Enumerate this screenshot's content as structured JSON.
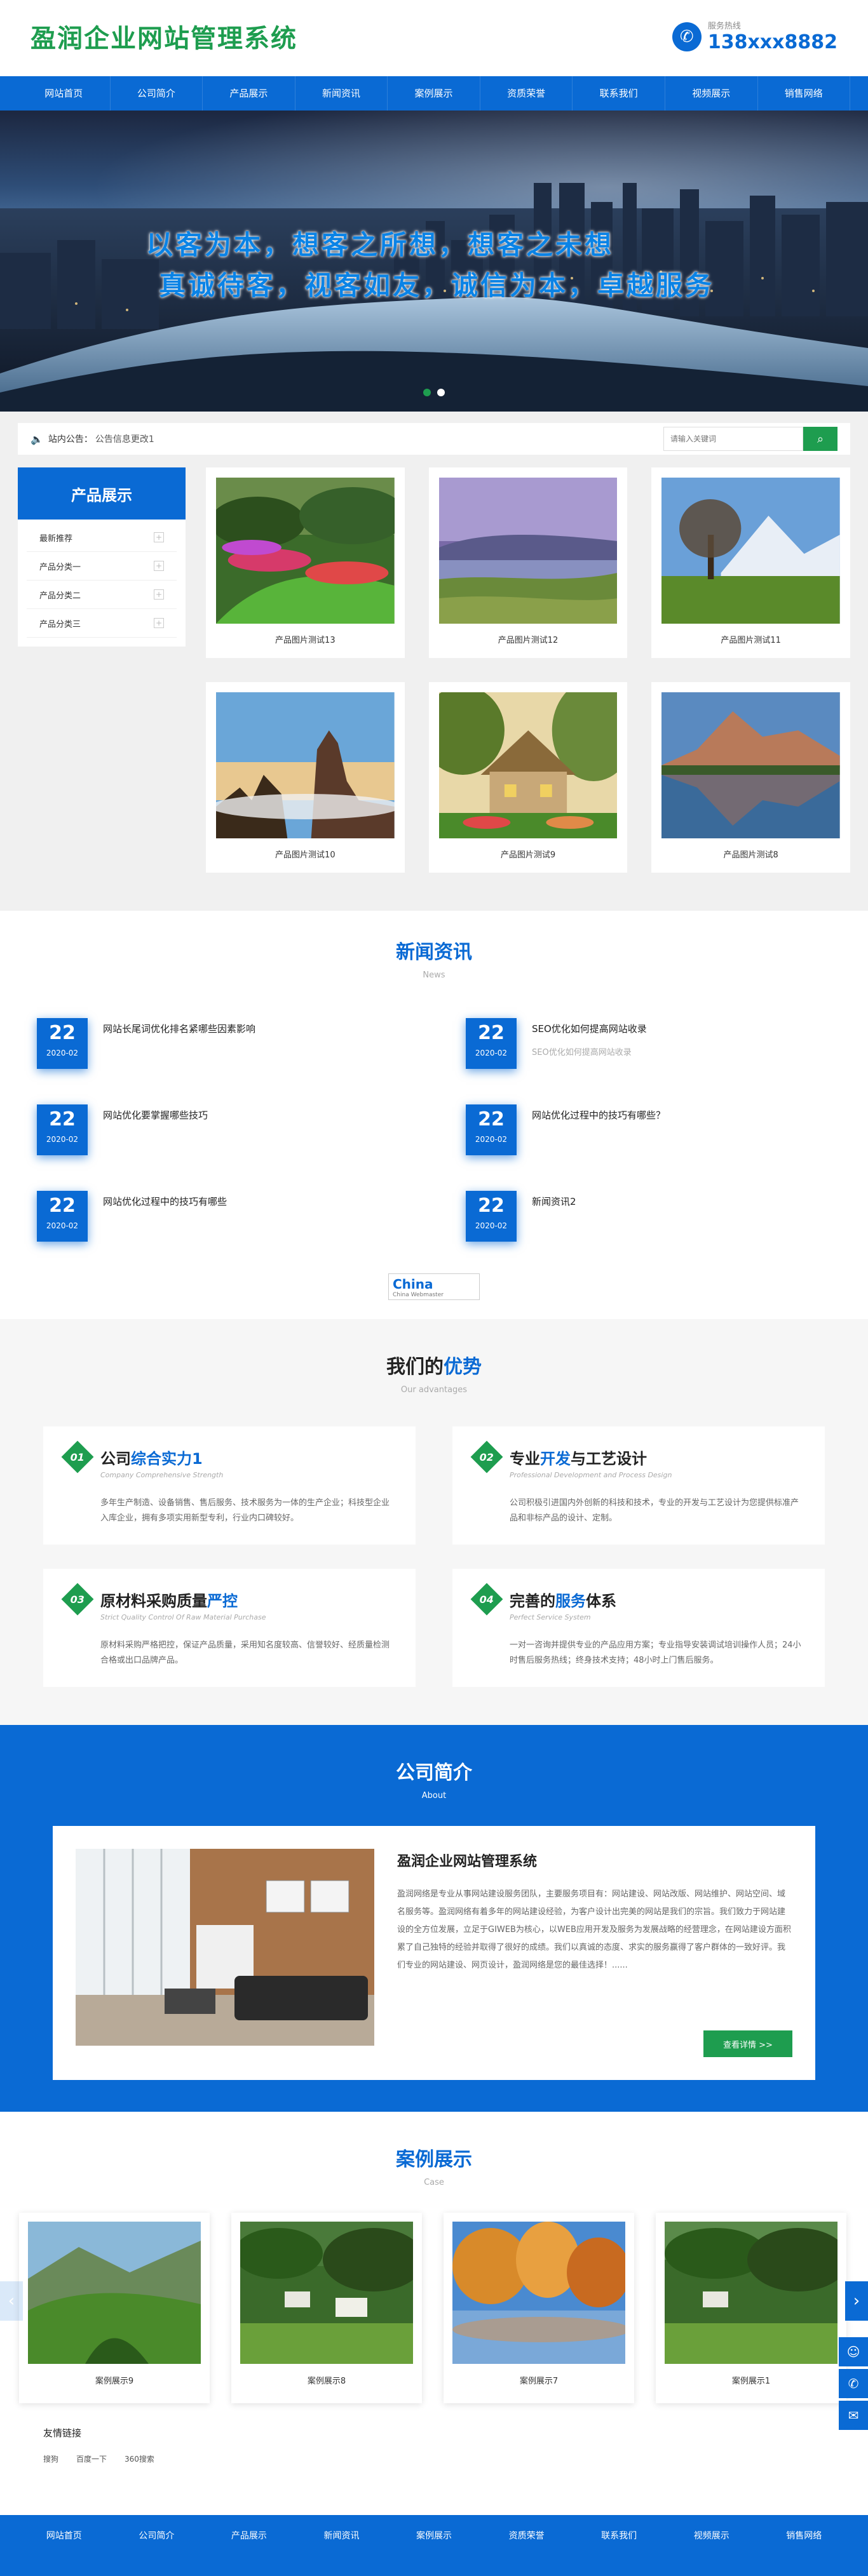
{
  "header": {
    "logo": "盈润企业网站管理系统",
    "hotline_label": "服务热线",
    "hotline_number": "138xxx8882"
  },
  "nav": [
    "网站首页",
    "公司简介",
    "产品展示",
    "新闻资讯",
    "案例展示",
    "资质荣誉",
    "联系我们",
    "视频展示",
    "销售网络"
  ],
  "banner": {
    "slogan1": "以客为本，想客之所想，想客之未想",
    "slogan2": "真诚待客，视客如友，诚信为本，卓越服务"
  },
  "notice": {
    "label": "站内公告：",
    "text": "公告信息更改1",
    "search_placeholder": "请输入关键词"
  },
  "products": {
    "side_title": "产品展示",
    "side_items": [
      "最新推荐",
      "产品分类一",
      "产品分类二",
      "产品分类三"
    ],
    "items": [
      "产品图片测试13",
      "产品图片测试12",
      "产品图片测试11",
      "产品图片测试10",
      "产品图片测试9",
      "产品图片测试8"
    ]
  },
  "news": {
    "title": "新闻资讯",
    "subtitle": "News",
    "items": [
      {
        "day": "22",
        "month": "2020-02",
        "title": "网站长尾词优化排名紧哪些因素影响",
        "desc": ""
      },
      {
        "day": "22",
        "month": "2020-02",
        "title": "SEO优化如何提高网站收录",
        "desc": "SEO优化如何提高网站收录"
      },
      {
        "day": "22",
        "month": "2020-02",
        "title": "网站优化要掌握哪些技巧",
        "desc": ""
      },
      {
        "day": "22",
        "month": "2020-02",
        "title": "网站优化过程中的技巧有哪些？",
        "desc": ""
      },
      {
        "day": "22",
        "month": "2020-02",
        "title": "网站优化过程中的技巧有哪些",
        "desc": ""
      },
      {
        "day": "22",
        "month": "2020-02",
        "title": "新闻资讯2",
        "desc": ""
      }
    ],
    "logo_text": "China",
    "logo_sub": "China Webmaster"
  },
  "advantages": {
    "title_a": "我们的",
    "title_b": "优势",
    "subtitle": "Our advantages",
    "items": [
      {
        "num": "01",
        "t1": "公司",
        "t2": "综合实力1",
        "t3": "",
        "sub": "Company Comprehensive Strength",
        "desc": "多年生产制造、设备销售、售后服务、技术服务为一体的生产企业；科技型企业入库企业，拥有多项实用新型专利，行业内口碑较好。"
      },
      {
        "num": "02",
        "t1": "专业",
        "t2": "开发",
        "t3": "与工艺设计",
        "sub": "Professional Development and Process Design",
        "desc": "公司积极引进国内外创新的科技和技术，专业的开发与工艺设计为您提供标准产品和非标产品的设计、定制。"
      },
      {
        "num": "03",
        "t1": "原材料采购质量",
        "t2": "严控",
        "t3": "",
        "sub": "Strict Quality Control Of Raw Material Purchase",
        "desc": "原材料采购严格把控，保证产品质量，采用知名度较高、信誉较好、经质量检测合格或出口品牌产品。"
      },
      {
        "num": "04",
        "t1": "完善的",
        "t2": "服务",
        "t3": "体系",
        "sub": "Perfect Service System",
        "desc": "一对一咨询并提供专业的产品应用方案；专业指导安装调试培训操作人员；24小时售后服务热线；终身技术支持；48小时上门售后服务。"
      }
    ]
  },
  "about": {
    "title": "公司简介",
    "subtitle": "About",
    "heading": "盈润企业网站管理系统",
    "text": "盈润网络是专业从事网站建设服务团队，主要服务项目有：网站建设、网站改版、网站维护、网站空间、域名服务等。盈润网络有着多年的网站建设经验，为客户设计出完美的网站是我们的宗旨。我们致力于网站建设的全方位发展，立足于GIWEB为核心，以WEB应用开发及服务为发展战略的经营理念，在网站建设方面积累了自己独特的经验并取得了很好的成绩。我们以真诚的态度、求实的服务赢得了客户群体的一致好评。我们专业的网站建设、网页设计，盈润网络是您的最佳选择！......",
    "button": "查看详情 >>"
  },
  "cases": {
    "title": "案例展示",
    "subtitle": "Case",
    "items": [
      "案例展示9",
      "案例展示8",
      "案例展示7",
      "案例展示1"
    ]
  },
  "links": {
    "title": "友情链接",
    "items": [
      "搜狗",
      "百度一下",
      "360搜索"
    ]
  },
  "footer": [
    "网站首页",
    "公司简介",
    "产品展示",
    "新闻资讯",
    "案例展示",
    "资质荣誉",
    "联系我们",
    "视频展示",
    "销售网络"
  ]
}
